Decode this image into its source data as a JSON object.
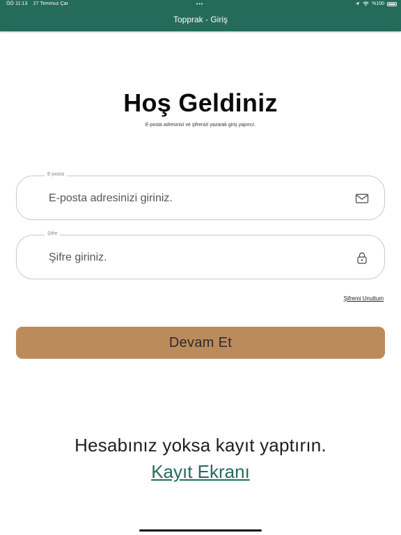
{
  "status_bar": {
    "time": "ÖÖ 11:13",
    "date": "27 Temmuz Çar",
    "dots": "•••",
    "battery": "%100"
  },
  "nav": {
    "title": "Topprak - Giriş"
  },
  "welcome": {
    "title": "Hoş Geldiniz",
    "subtitle": "E-posta adresinizi ve şifrenizi yazarak giriş yapınız."
  },
  "email_field": {
    "label": "E-posta",
    "placeholder": "E-posta adresinizi giriniz.",
    "icon": "mail-icon"
  },
  "password_field": {
    "label": "Şifre",
    "placeholder": "Şifre giriniz.",
    "icon": "lock-icon"
  },
  "forgot_password": "Şifremi Unuttum",
  "continue_button": "Devam Et",
  "register": {
    "prompt": "Hesabınız yoksa kayıt yaptırın.",
    "link": "Kayıt Ekranı"
  },
  "colors": {
    "header": "#256b5b",
    "button": "#bc8b5c",
    "link": "#256b5b"
  }
}
